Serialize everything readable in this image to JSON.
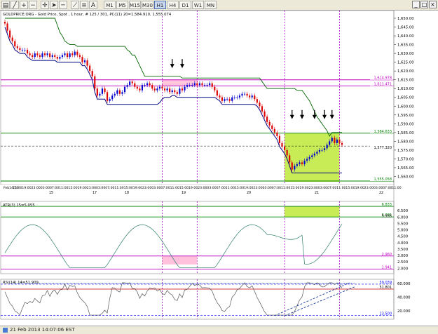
{
  "toolbar": {
    "buttons": [
      {
        "label": "",
        "icon": "new-chart-icon"
      },
      {
        "label": "",
        "icon": "line-tool-icon"
      },
      {
        "label": "",
        "icon": "zoom-in-icon"
      },
      {
        "label": "",
        "icon": "zoom-out-icon"
      },
      {
        "label": "",
        "icon": "crosshair-icon"
      },
      {
        "label": "",
        "icon": "cursor-icon"
      },
      {
        "label": "",
        "icon": "hline-icon"
      },
      {
        "label": "",
        "icon": "trendline-icon"
      },
      {
        "label": "",
        "icon": "fibonacci-icon"
      },
      {
        "label": "",
        "icon": "text-icon"
      }
    ],
    "timeframes": [
      "M1",
      "M5",
      "M15",
      "M30",
      "H1",
      "H4",
      "D1",
      "W1",
      "MN"
    ],
    "active_timeframe": "H1",
    "window_controls": [
      "_",
      "□",
      "×"
    ]
  },
  "chart": {
    "title": "GOLDPRICE.ORG - Gold Price, Spot , 1 hour, # 125 / 301, PC(11) 20=1,584.910, 1,555.074",
    "price_scale": [
      "1,650.00",
      "1,645.00",
      "1,640.00",
      "1,635.00",
      "1,630.00",
      "1,625.00",
      "1,620.00",
      "1,615.00",
      "1,610.00",
      "1,605.00",
      "1,600.00",
      "1,595.00",
      "1,590.00",
      "1,585.00",
      "1,580.00",
      "1,575.00",
      "1,570.00",
      "1,565.00",
      "1,560.00"
    ],
    "price_tags": [
      {
        "text": "1,614.978",
        "color": "#c000c0"
      },
      {
        "text": "1,611.471",
        "color": "#c000c0"
      },
      {
        "text": "1,584.633",
        "color": "#008000"
      },
      {
        "text": "1,577.320",
        "color": "#000000"
      },
      {
        "text": "1,555.058",
        "color": "#008000"
      }
    ],
    "time_axis": [
      "Feb14/13",
      "15:00",
      "19:00",
      "23:00",
      "03:00",
      "07:00",
      "11:00",
      "15:00",
      "19:00",
      "23:00",
      "03:00",
      "07:00",
      "11:00",
      "15:00",
      "19:00",
      "23:00",
      "03:00",
      "07:00",
      "11:00",
      "15:00",
      "19:00",
      "23:00",
      "03:00",
      "07:00",
      "11:00",
      "15:00",
      "19:00",
      "23:00",
      "03:00",
      "07:00",
      "11:00",
      "15:00",
      "19:00",
      "23:00",
      "03:00",
      "07:00",
      "11:00",
      "15:00",
      "19:00",
      "23:00",
      "03:00",
      "07:00",
      "11:00"
    ],
    "day_labels": [
      "15",
      "17",
      "18",
      "19",
      "20",
      "21",
      "22"
    ],
    "down_arrow_count": 7
  },
  "indicators": {
    "atr": {
      "title": "ATR(3) 15=5.055",
      "scale": [
        "6.500",
        "6.000",
        "5.500",
        "5.000",
        "4.500",
        "4.000",
        "3.500",
        "3.000",
        "2.500",
        "2.000"
      ],
      "tags": [
        {
          "text": "6.833",
          "color": "#008000"
        },
        {
          "text": "6.005",
          "color": "#008000"
        },
        {
          "text": "5.935",
          "color": "#000000"
        },
        {
          "text": "2.960",
          "color": "#c000c0"
        },
        {
          "text": "1.941",
          "color": "#c000c0"
        }
      ]
    },
    "rsi": {
      "title": "RSI(14) 14=51.909",
      "scale": [
        "60.000",
        "40.000",
        "20.000"
      ],
      "tags": [
        {
          "text": "59.039",
          "color": "#0000ff"
        },
        {
          "text": "51.801",
          "color": "#000000"
        },
        {
          "text": "13.500",
          "color": "#0000ff"
        }
      ]
    }
  },
  "status": {
    "text": "21 Feb 2013 14:07:06 EST"
  },
  "colors": {
    "bull": "#0000cc",
    "bear": "#dd0000",
    "upper_band": "#006400",
    "lower_band": "#000080",
    "vline": "#a020c0",
    "highlight_green": "#b5e61d",
    "highlight_pink": "#ffb6d5"
  },
  "chart_data": {
    "type": "candlestick",
    "title": "GOLDPRICE.ORG - Gold Price, Spot , 1 hour",
    "xlabel": "",
    "ylabel": "",
    "ylim": [
      1557,
      1652
    ],
    "close_series": [
      1647,
      1643,
      1639,
      1637,
      1634,
      1633,
      1632,
      1632,
      1632,
      1630,
      1629,
      1628,
      1630,
      1629,
      1628,
      1630,
      1629,
      1630,
      1628,
      1629,
      1628,
      1627,
      1628,
      1629,
      1630,
      1628,
      1630,
      1629,
      1631,
      1629,
      1628,
      1625,
      1626,
      1623,
      1620,
      1617,
      1610,
      1606,
      1607,
      1610,
      1608,
      1603,
      1604,
      1606,
      1607,
      1609,
      1607,
      1608,
      1611,
      1612,
      1614,
      1613,
      1611,
      1610,
      1609,
      1612,
      1612,
      1613,
      1612,
      1610,
      1609,
      1610,
      1611,
      1610,
      1609,
      1610,
      1608,
      1609,
      1608,
      1607,
      1610,
      1609,
      1611,
      1612,
      1612,
      1612,
      1613,
      1612,
      1613,
      1612,
      1612,
      1612,
      1613,
      1611,
      1609,
      1606,
      1605,
      1603,
      1604,
      1604,
      1603,
      1605,
      1605,
      1605,
      1606,
      1607,
      1607,
      1606,
      1605,
      1606,
      1604,
      1602,
      1600,
      1597,
      1594,
      1591,
      1589,
      1587,
      1585,
      1583,
      1579,
      1577,
      1575,
      1572,
      1568,
      1564,
      1566,
      1567,
      1568,
      1567,
      1569,
      1570,
      1571,
      1572,
      1573,
      1574,
      1575,
      1575,
      1576,
      1578,
      1580,
      1582,
      1579,
      1581,
      1579,
      1578
    ]
  }
}
